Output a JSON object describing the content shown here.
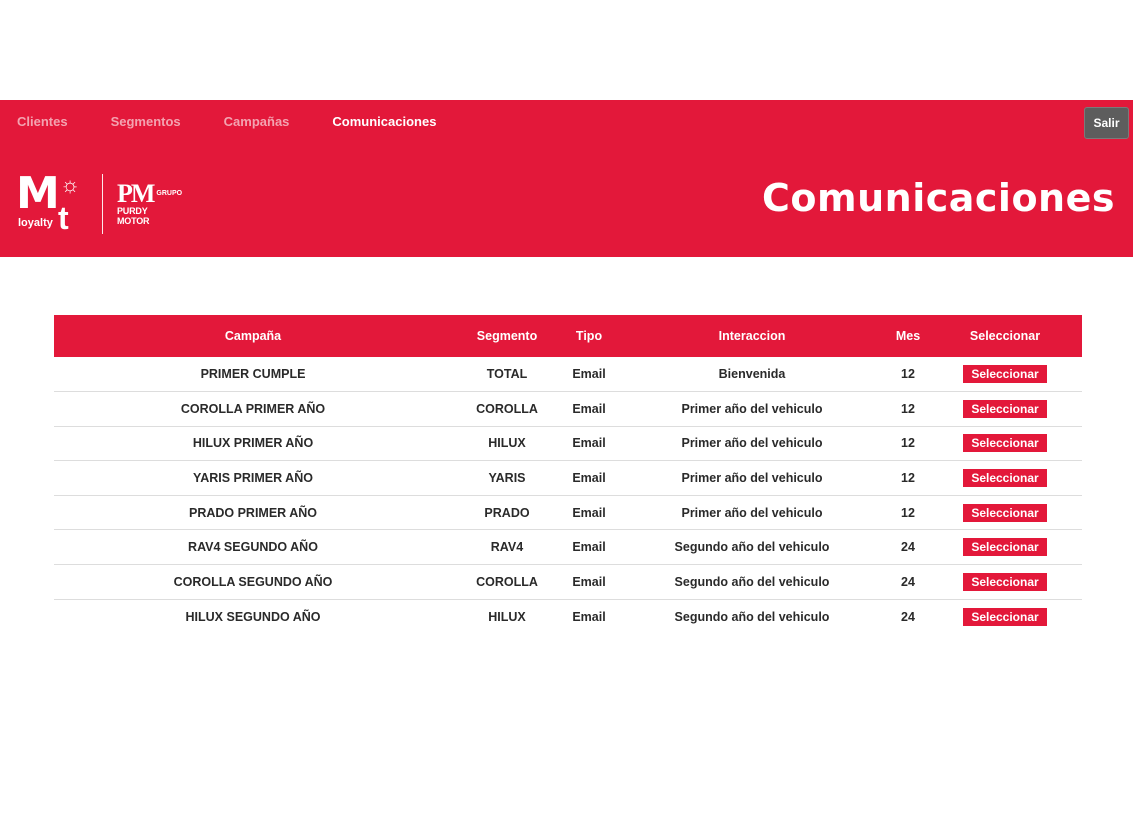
{
  "nav": {
    "items": [
      {
        "label": "Clientes",
        "active": false
      },
      {
        "label": "Segmentos",
        "active": false
      },
      {
        "label": "Campañas",
        "active": false
      },
      {
        "label": "Comunicaciones",
        "active": true
      }
    ],
    "logout_label": "Salir"
  },
  "brand": {
    "mt_logo_big": "M",
    "mt_logo_t": "t",
    "mt_logo_sub": "loyalty",
    "pm_logo": "PM",
    "pm_logo_small": "GRUPO",
    "pm_logo_sub": "PURDY MOTOR"
  },
  "page_title": "Comunicaciones",
  "table": {
    "headers": {
      "campana": "Campaña",
      "segmento": "Segmento",
      "tipo": "Tipo",
      "interaccion": "Interaccion",
      "mes": "Mes",
      "seleccionar": "Seleccionar"
    },
    "rows": [
      {
        "campana": "PRIMER CUMPLE",
        "segmento": "TOTAL",
        "tipo": "Email",
        "interaccion": "Bienvenida",
        "mes": "12",
        "action": "Seleccionar"
      },
      {
        "campana": "COROLLA PRIMER AÑO",
        "segmento": "COROLLA",
        "tipo": "Email",
        "interaccion": "Primer año del vehiculo",
        "mes": "12",
        "action": "Seleccionar"
      },
      {
        "campana": "HILUX PRIMER AÑO",
        "segmento": "HILUX",
        "tipo": "Email",
        "interaccion": "Primer año del vehiculo",
        "mes": "12",
        "action": "Seleccionar"
      },
      {
        "campana": "YARIS PRIMER AÑO",
        "segmento": "YARIS",
        "tipo": "Email",
        "interaccion": "Primer año del vehiculo",
        "mes": "12",
        "action": "Seleccionar"
      },
      {
        "campana": "PRADO PRIMER AÑO",
        "segmento": "PRADO",
        "tipo": "Email",
        "interaccion": "Primer año del vehiculo",
        "mes": "12",
        "action": "Seleccionar"
      },
      {
        "campana": "RAV4 SEGUNDO AÑO",
        "segmento": "RAV4",
        "tipo": "Email",
        "interaccion": "Segundo año del vehiculo",
        "mes": "24",
        "action": "Seleccionar"
      },
      {
        "campana": "COROLLA SEGUNDO AÑO",
        "segmento": "COROLLA",
        "tipo": "Email",
        "interaccion": "Segundo año del vehiculo",
        "mes": "24",
        "action": "Seleccionar"
      },
      {
        "campana": "HILUX SEGUNDO AÑO",
        "segmento": "HILUX",
        "tipo": "Email",
        "interaccion": "Segundo año del vehiculo",
        "mes": "24",
        "action": "Seleccionar"
      }
    ]
  },
  "colors": {
    "brand_red": "#e3183a",
    "logout_gray": "#5d5d5d"
  }
}
